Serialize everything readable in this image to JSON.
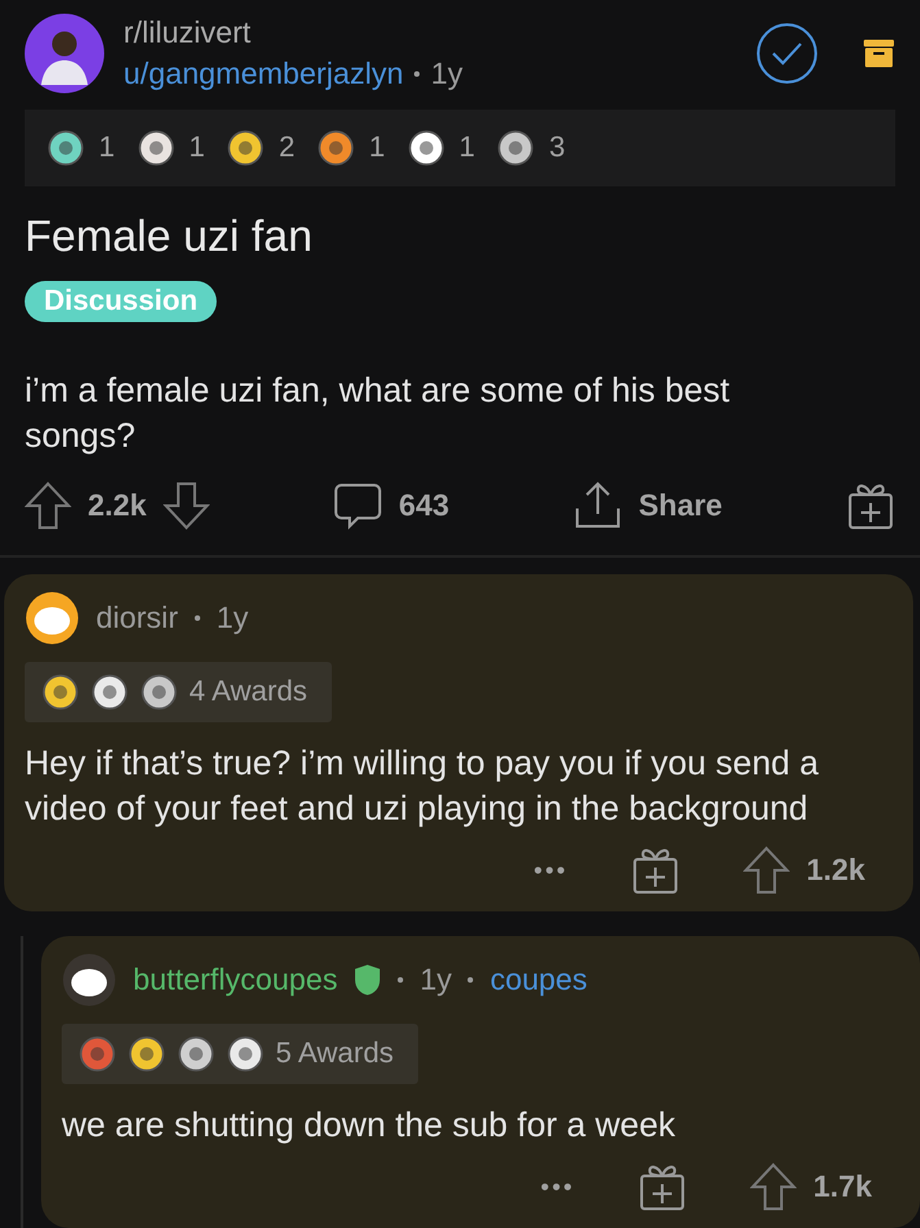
{
  "post": {
    "subreddit": "r/liluzivert",
    "author": "u/gangmemberjazlyn",
    "age": "1y",
    "awards": [
      {
        "count": "1",
        "color": "#6fd3c0"
      },
      {
        "count": "1",
        "color": "#e9e3e0"
      },
      {
        "count": "2",
        "color": "#f0c430"
      },
      {
        "count": "1",
        "color": "#f08a2a"
      },
      {
        "count": "1",
        "color": "#ffffff"
      },
      {
        "count": "3",
        "color": "#c8c8c8"
      }
    ],
    "title": "Female uzi fan",
    "flair": "Discussion",
    "body": "i’m a female uzi fan, what are some of his best songs?",
    "score": "2.2k",
    "comments": "643",
    "share": "Share"
  },
  "comments": [
    {
      "author": "diorsir",
      "age": "1y",
      "awards": [
        {
          "color": "#f0c430"
        },
        {
          "color": "#e9e9e9"
        },
        {
          "color": "#c8c8c8"
        }
      ],
      "awards_label": "4 Awards",
      "body": "Hey if that’s true? i’m willing to pay you if you send a video of your feet and uzi playing in the background",
      "more": "•••",
      "score": "1.2k",
      "replies": [
        {
          "author": "butterflycoupes",
          "age": "1y",
          "flair": "coupes",
          "awards": [
            {
              "color": "#e0573a"
            },
            {
              "color": "#f0c430"
            },
            {
              "color": "#cfcfcf"
            },
            {
              "color": "#e9e9e9"
            }
          ],
          "awards_label": "5 Awards",
          "body": "we are shutting down the sub for a week",
          "more": "•••",
          "score": "1.7k"
        }
      ]
    }
  ]
}
